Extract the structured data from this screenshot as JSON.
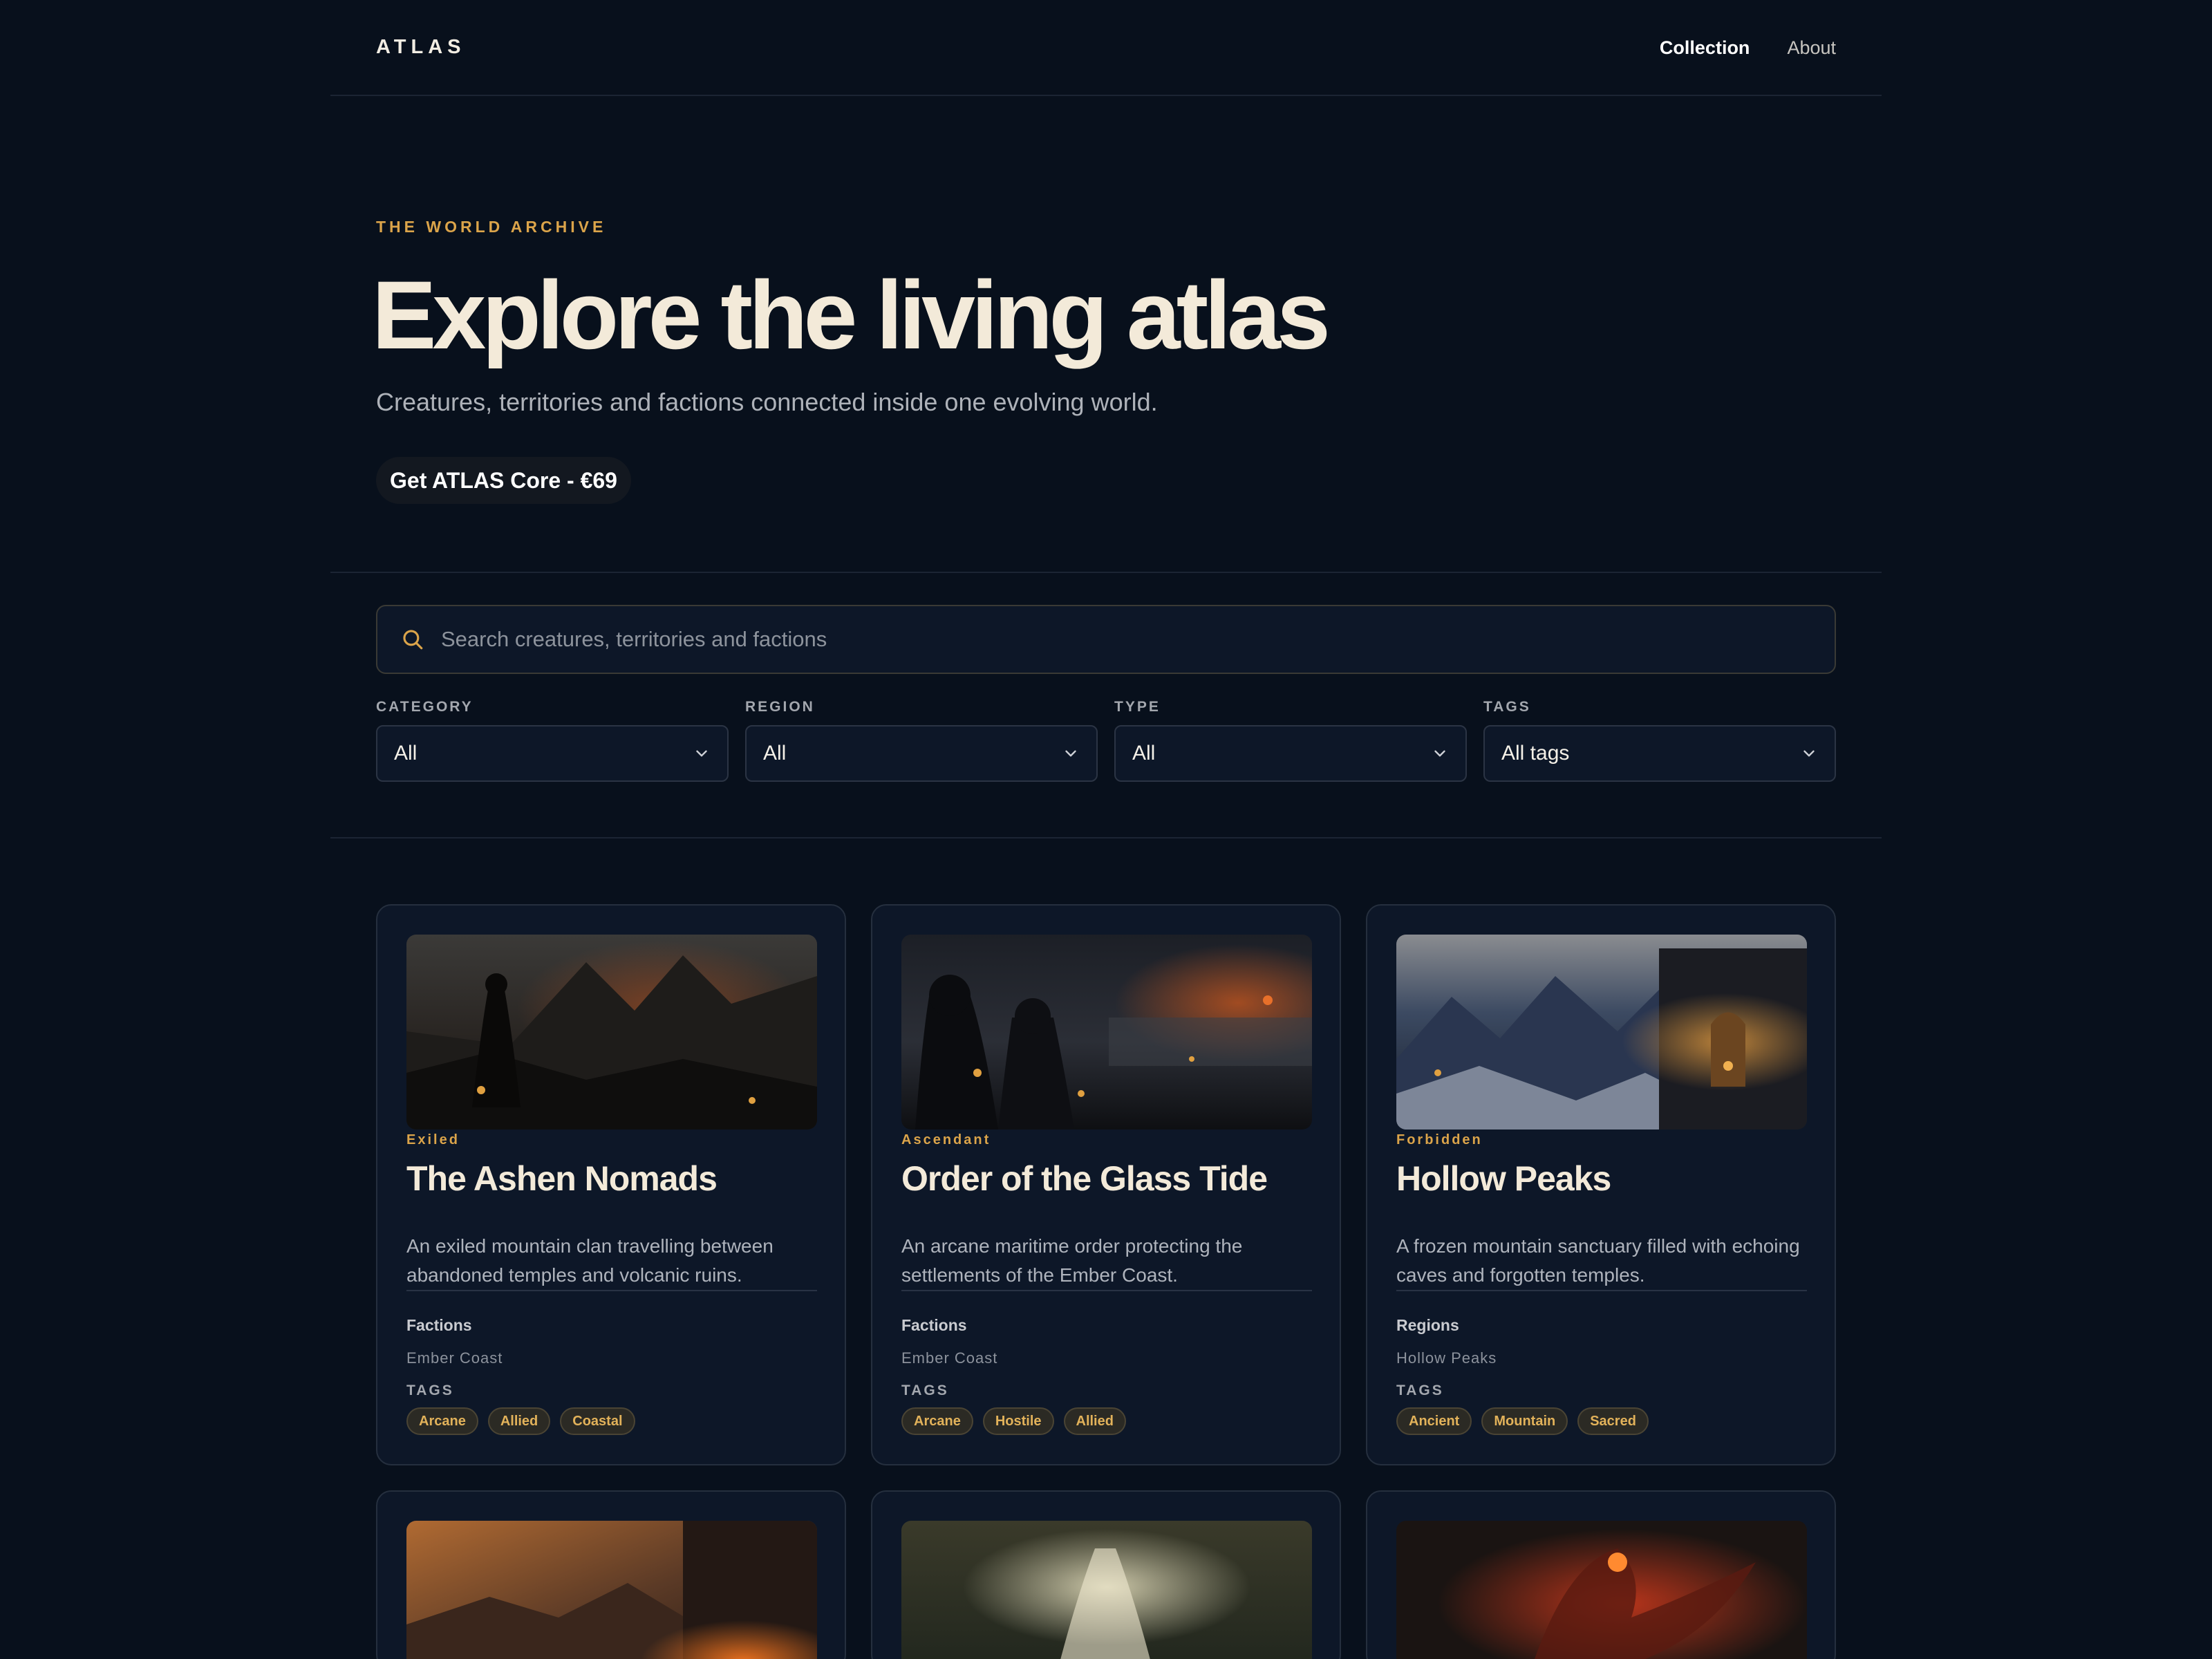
{
  "header": {
    "logo": "ATLAS",
    "nav": [
      {
        "label": "Collection",
        "active": true
      },
      {
        "label": "About",
        "active": false
      }
    ]
  },
  "hero": {
    "eyebrow": "THE WORLD ARCHIVE",
    "title": "Explore the living atlas",
    "subtitle": "Creatures, territories and factions connected inside one evolving world.",
    "cta": "Get ATLAS Core - €69"
  },
  "search": {
    "placeholder": "Search creatures, territories and factions"
  },
  "filters": [
    {
      "label": "CATEGORY",
      "value": "All"
    },
    {
      "label": "REGION",
      "value": "All"
    },
    {
      "label": "TYPE",
      "value": "All"
    },
    {
      "label": "TAGS",
      "value": "All tags"
    }
  ],
  "cards": [
    {
      "badge": "Exiled",
      "title": "The Ashen Nomads",
      "description": "An exiled mountain clan travelling between abandoned temples and volcanic ruins.",
      "section": "Factions",
      "section_value": "Ember Coast",
      "tags_label": "TAGS",
      "tags": [
        "Arcane",
        "Allied",
        "Coastal"
      ]
    },
    {
      "badge": "Ascendant",
      "title": "Order of the Glass Tide",
      "description": "An arcane maritime order protecting the settlements of the Ember Coast.",
      "section": "Factions",
      "section_value": "Ember Coast",
      "tags_label": "TAGS",
      "tags": [
        "Arcane",
        "Hostile",
        "Allied"
      ]
    },
    {
      "badge": "Forbidden",
      "title": "Hollow Peaks",
      "description": "A frozen mountain sanctuary filled with echoing caves and forgotten temples.",
      "section": "Regions",
      "section_value": "Hollow Peaks",
      "tags_label": "TAGS",
      "tags": [
        "Ancient",
        "Mountain",
        "Sacred"
      ]
    }
  ],
  "colors": {
    "background": "#08101c",
    "accent": "#dba44a",
    "card": "#0d1728",
    "heading": "#f3ead9"
  }
}
